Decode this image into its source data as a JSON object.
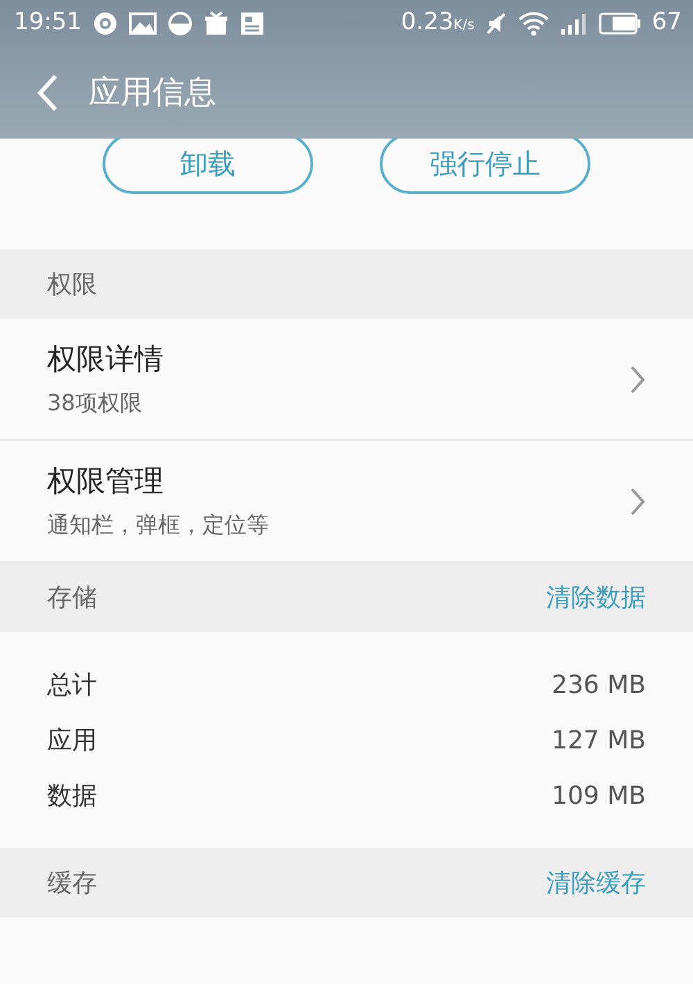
{
  "status_bar": {
    "time": "19:51",
    "speed": "0.23",
    "speed_unit": "K/s",
    "battery": "67"
  },
  "app_bar": {
    "title": "应用信息"
  },
  "actions": [
    {
      "label": "卸载"
    },
    {
      "label": "强行停止"
    }
  ],
  "sections": [
    {
      "kind": "list",
      "header": "权限",
      "items": [
        {
          "title": "权限详情",
          "subtitle": "38项权限"
        },
        {
          "title": "权限管理",
          "subtitle": "通知栏，弹框，定位等"
        }
      ]
    },
    {
      "kind": "table",
      "header": "存储",
      "action": "清除数据",
      "rows": [
        {
          "label": "总计",
          "value": "236 MB"
        },
        {
          "label": "应用",
          "value": "127 MB"
        },
        {
          "label": "数据",
          "value": "109 MB"
        }
      ]
    },
    {
      "kind": "table",
      "header": "缓存",
      "action": "清除缓存"
    }
  ]
}
